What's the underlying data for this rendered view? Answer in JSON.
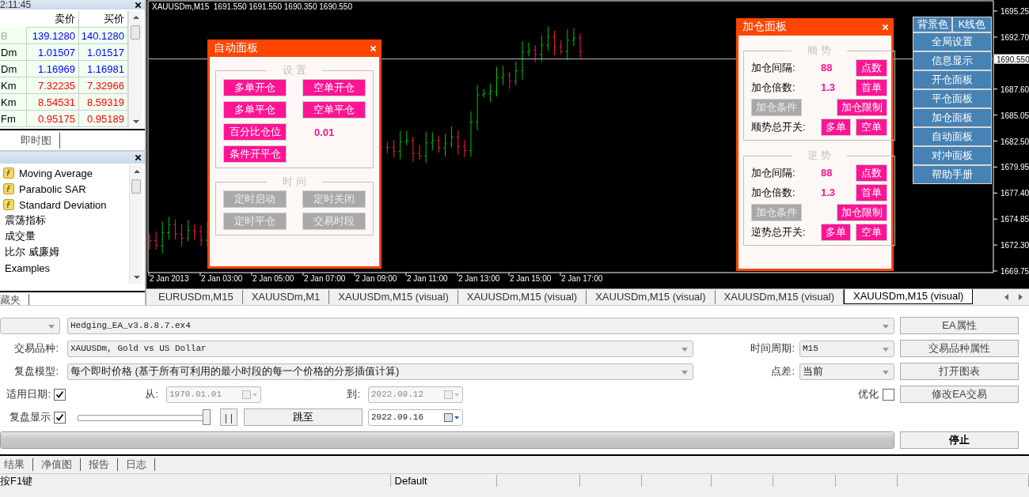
{
  "market_watch": {
    "time": "2:11:45",
    "columns": [
      "卖价",
      "买价"
    ],
    "rows": [
      {
        "symbol": "B",
        "bid": "139.1280",
        "ask": "140.1280",
        "color": "#0000ff",
        "disabled": true
      },
      {
        "symbol": "Dm",
        "bid": "1.01507",
        "ask": "1.01517",
        "color": "#0000ff",
        "disabled": false
      },
      {
        "symbol": "Dm",
        "bid": "1.16969",
        "ask": "1.16981",
        "color": "#0000ff",
        "disabled": false
      },
      {
        "symbol": "Km",
        "bid": "7.32235",
        "ask": "7.32966",
        "color": "#ff0000",
        "disabled": false
      },
      {
        "symbol": "Km",
        "bid": "8.54531",
        "ask": "8.59319",
        "color": "#ff0000",
        "disabled": false
      },
      {
        "symbol": "Fm",
        "bid": "0.95175",
        "ask": "0.95189",
        "color": "#ff0000",
        "disabled": false
      }
    ],
    "tabs": [
      {
        "label": "即时图",
        "selected": false
      }
    ]
  },
  "navigator": {
    "items": [
      {
        "label": "Moving Average",
        "kind": "indicator"
      },
      {
        "label": "Parabolic SAR",
        "kind": "indicator"
      },
      {
        "label": "Standard Deviation",
        "kind": "indicator"
      },
      {
        "label": "震荡指标",
        "kind": "folder"
      },
      {
        "label": "成交量",
        "kind": "folder"
      },
      {
        "label": "比尔 威廉姆",
        "kind": "folder"
      },
      {
        "label": "Examples",
        "kind": "folder"
      }
    ],
    "tabs": [
      {
        "label": "藏夹",
        "selected": false
      }
    ]
  },
  "chart": {
    "title": "XAUUSDm,M15  1691.550 1691.550 1690.350 1690.550",
    "price_axis": [
      "1695.25",
      "1692.70",
      "1687.60",
      "1685.05",
      "1682.50",
      "1679.95",
      "1677.40",
      "1674.85",
      "1672.30",
      "1669.75"
    ],
    "current_price": "1690.550",
    "time_axis": [
      "2 Jan 2013",
      "2 Jan 03:00",
      "2 Jan 05:00",
      "2 Jan 07:00",
      "2 Jan 09:00",
      "2 Jan 11:00",
      "2 Jan 13:00",
      "2 Jan 15:00",
      "2 Jan 17:00"
    ]
  },
  "auto_panel": {
    "title": "自动面板",
    "sections": [
      {
        "legend": "设 置",
        "rows": [
          [
            {
              "kind": "button",
              "label": "多单开仓",
              "disabled": false
            },
            {
              "kind": "button",
              "label": "空单开仓",
              "disabled": false
            }
          ],
          [
            {
              "kind": "button",
              "label": "多单平仓",
              "disabled": false
            },
            {
              "kind": "button",
              "label": "空单平仓",
              "disabled": false
            }
          ],
          [
            {
              "kind": "button",
              "label": "百分比仓位",
              "disabled": false
            },
            {
              "kind": "value",
              "text": "0.01"
            }
          ],
          [
            {
              "kind": "button",
              "label": "条件开平仓",
              "disabled": false
            }
          ]
        ]
      },
      {
        "legend": "时 间",
        "rows": [
          [
            {
              "kind": "button",
              "label": "定时启动",
              "disabled": true
            },
            {
              "kind": "button",
              "label": "定时关闭",
              "disabled": true
            }
          ],
          [
            {
              "kind": "button",
              "label": "定时平仓",
              "disabled": true
            },
            {
              "kind": "button",
              "label": "交易时段",
              "disabled": true
            }
          ]
        ]
      }
    ]
  },
  "add_panel": {
    "title": "加仓面板",
    "sections": [
      {
        "legend": "顺 势",
        "rows": [
          [
            {
              "kind": "label",
              "text": "加仓间隔:"
            },
            {
              "kind": "value",
              "text": "88"
            },
            {
              "kind": "button",
              "label": "点数",
              "disabled": false
            }
          ],
          [
            {
              "kind": "label",
              "text": "加仓倍数:"
            },
            {
              "kind": "value",
              "text": "1.3"
            },
            {
              "kind": "button",
              "label": "首单",
              "disabled": false
            }
          ],
          [
            {
              "kind": "button",
              "label": "加仓条件",
              "disabled": true
            },
            {
              "kind": "button",
              "label": "加仓限制",
              "disabled": false
            }
          ],
          [
            {
              "kind": "label",
              "text": "顺势总开关:"
            },
            {
              "kind": "button",
              "label": "多单",
              "disabled": false
            },
            {
              "kind": "button",
              "label": "空单",
              "disabled": false
            }
          ]
        ]
      },
      {
        "legend": "逆 势",
        "rows": [
          [
            {
              "kind": "label",
              "text": "加仓间隔:"
            },
            {
              "kind": "value",
              "text": "88"
            },
            {
              "kind": "button",
              "label": "点数",
              "disabled": false
            }
          ],
          [
            {
              "kind": "label",
              "text": "加仓倍数:"
            },
            {
              "kind": "value",
              "text": "1.3"
            },
            {
              "kind": "button",
              "label": "首单",
              "disabled": false
            }
          ],
          [
            {
              "kind": "button",
              "label": "加仓条件",
              "disabled": true
            },
            {
              "kind": "button",
              "label": "加仓限制",
              "disabled": false
            }
          ],
          [
            {
              "kind": "label",
              "text": "逆势总开关:"
            },
            {
              "kind": "button",
              "label": "多单",
              "disabled": false
            },
            {
              "kind": "button",
              "label": "空单",
              "disabled": false
            }
          ]
        ]
      }
    ]
  },
  "side_buttons": {
    "colors": [
      "背景色",
      "K线色"
    ],
    "menu": [
      "全局设置",
      "信息显示",
      "开仓面板",
      "平仓面板",
      "加仓面板",
      "自动面板",
      "对冲面板",
      "帮助手册"
    ]
  },
  "chart_tabs": [
    {
      "label": "EURUSDm,M15",
      "selected": false
    },
    {
      "label": "XAUUSDm,M1",
      "selected": false
    },
    {
      "label": "XAUUSDm,M15 (visual)",
      "selected": false
    },
    {
      "label": "XAUUSDm,M15 (visual)",
      "selected": false
    },
    {
      "label": "XAUUSDm,M15 (visual)",
      "selected": false
    },
    {
      "label": "XAUUSDm,M15 (visual)",
      "selected": false
    },
    {
      "label": "XAUUSDm,M15 (visual)",
      "selected": true
    }
  ],
  "tester": {
    "expert": "Hedging_EA_v3.8.8.7.ex4",
    "symbol": {
      "label": "交易品种:",
      "value": "XAUUSDm, Gold vs US Dollar"
    },
    "period": {
      "label": "时间周期:",
      "value": "M15"
    },
    "model": {
      "label": "复盘模型:",
      "value": "每个即时价格 (基于所有可利用的最小时段的每一个价格的分形插值计算)"
    },
    "spread": {
      "label": "点差:",
      "value": "当前"
    },
    "use_date": {
      "label": "适用日期:",
      "checked": true
    },
    "from": {
      "label": "从:",
      "value": "1970.01.01",
      "disabled": true
    },
    "to": {
      "label": "到:",
      "value": "2022.09.12",
      "disabled": true
    },
    "optimization": {
      "label": "优化",
      "checked": false
    },
    "visual": {
      "label": "复盘显示",
      "checked": true
    },
    "speed": {
      "level": 1
    },
    "pause_button": "| |",
    "skip_button": "跳至",
    "skip_date": {
      "value": "2022.09.16",
      "disabled": false
    },
    "buttons": [
      "EA属性",
      "交易品种属性",
      "打开图表",
      "修改EA交易"
    ],
    "progress": {
      "level": 1
    },
    "stop_button": "停止"
  },
  "tester_tabs": [
    {
      "label": "结果",
      "selected": false
    },
    {
      "label": "净值图",
      "selected": false
    },
    {
      "label": "报告",
      "selected": false
    },
    {
      "label": "日志",
      "selected": false
    }
  ],
  "status_bar": {
    "help": "按F1键",
    "profile": "Default"
  }
}
